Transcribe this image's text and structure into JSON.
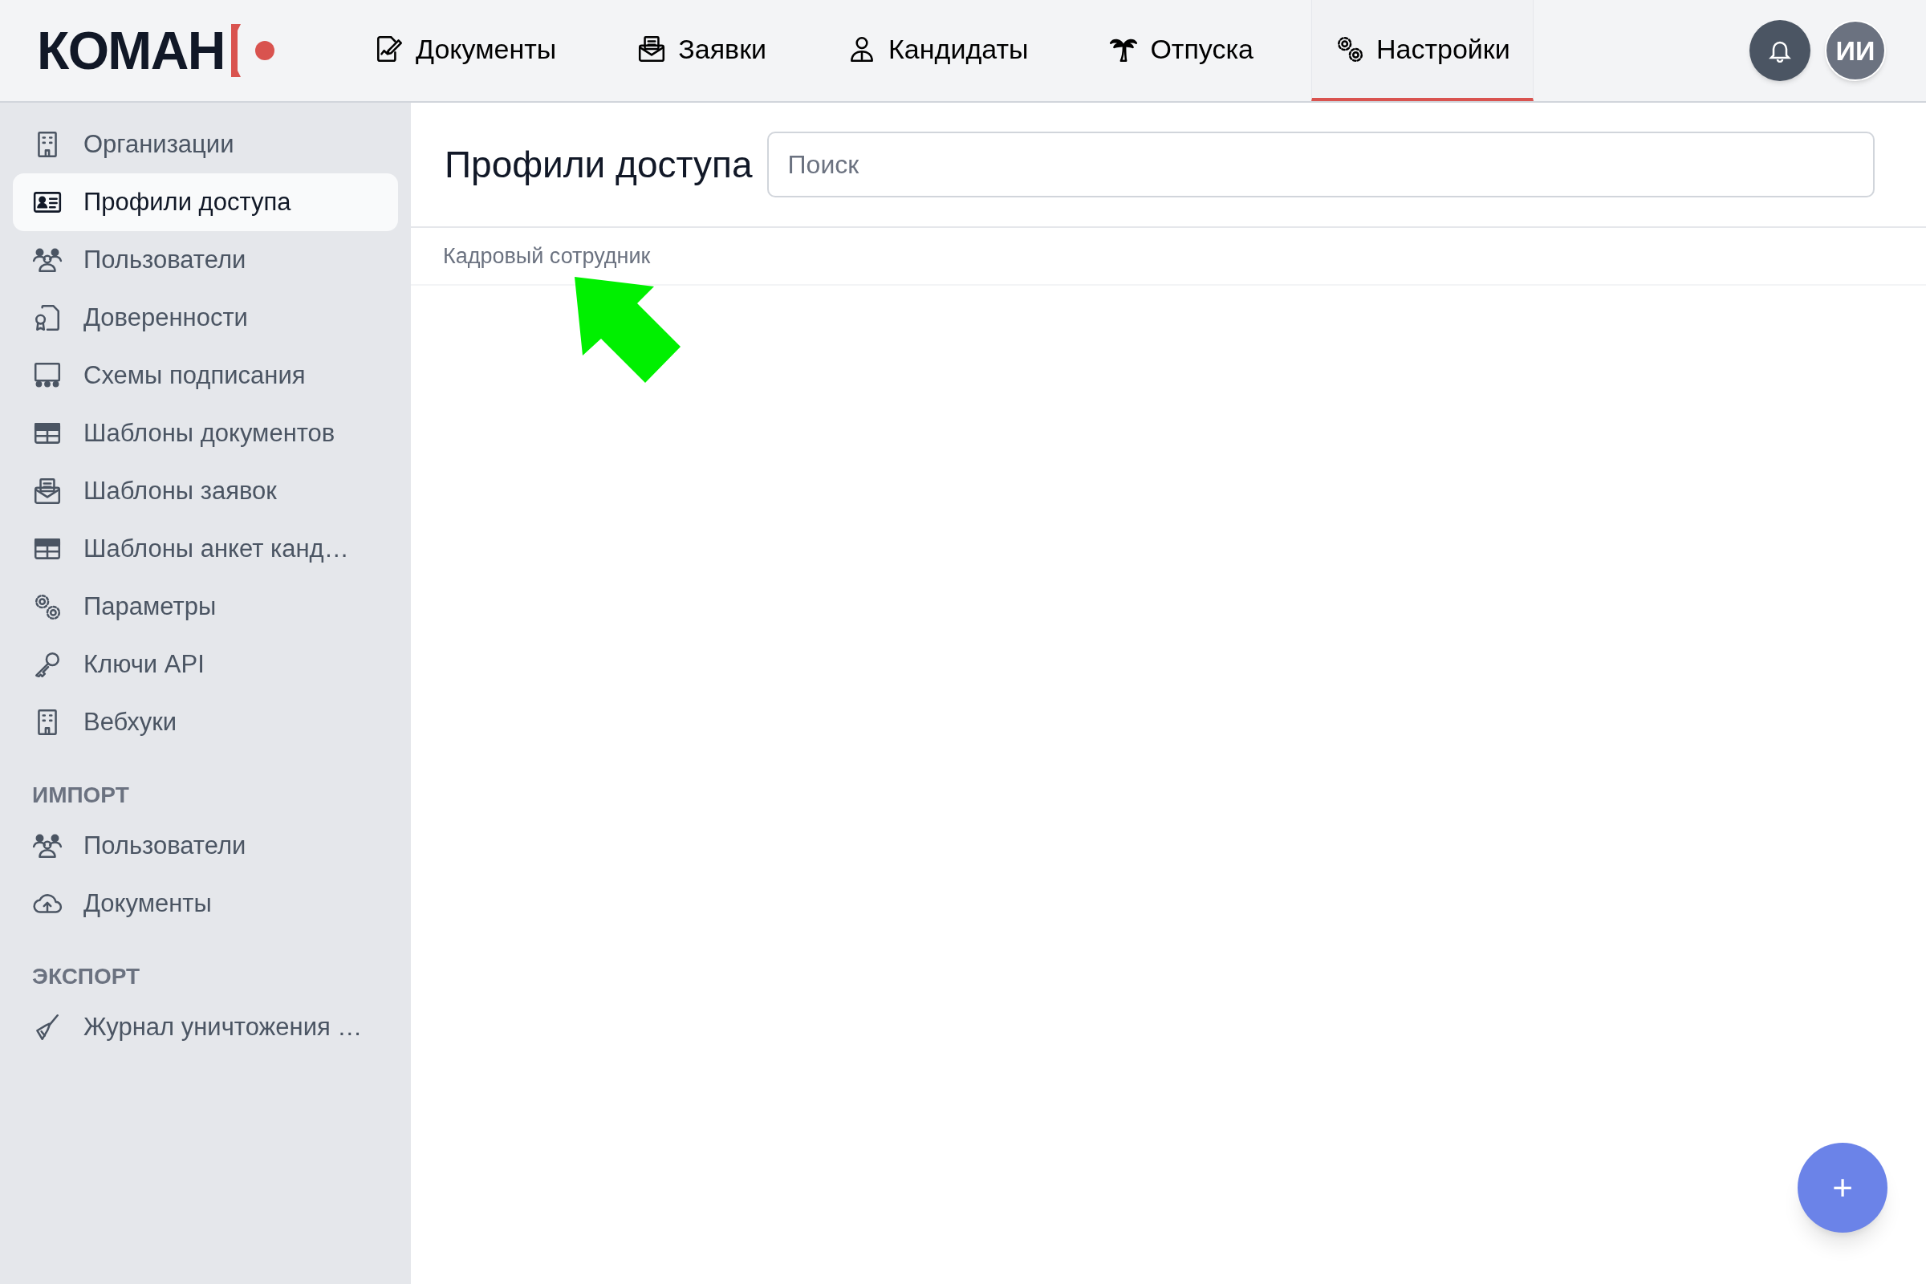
{
  "logo": "КОМАН",
  "nav": [
    {
      "label": "Документы",
      "selected": false
    },
    {
      "label": "Заявки",
      "selected": false
    },
    {
      "label": "Кандидаты",
      "selected": false
    },
    {
      "label": "Отпуска",
      "selected": false
    },
    {
      "label": "Настройки",
      "selected": true
    }
  ],
  "avatar": {
    "initials": "ИИ"
  },
  "sidebar": {
    "sections": [
      {
        "items": [
          {
            "label": "Организации",
            "selected": false
          },
          {
            "label": "Профили доступа",
            "selected": true
          },
          {
            "label": "Пользователи",
            "selected": false
          },
          {
            "label": "Доверенности",
            "selected": false
          },
          {
            "label": "Схемы подписания",
            "selected": false
          },
          {
            "label": "Шаблоны документов",
            "selected": false
          },
          {
            "label": "Шаблоны заявок",
            "selected": false
          },
          {
            "label": "Шаблоны анкет канд…",
            "selected": false
          },
          {
            "label": "Параметры",
            "selected": false
          },
          {
            "label": "Ключи API",
            "selected": false
          },
          {
            "label": "Вебхуки",
            "selected": false
          }
        ]
      },
      {
        "title": "ИМПОРТ",
        "items": [
          {
            "label": "Пользователи",
            "selected": false
          },
          {
            "label": "Документы",
            "selected": false
          }
        ]
      },
      {
        "title": "ЭКСПОРТ",
        "items": [
          {
            "label": "Журнал уничтожения …",
            "selected": false
          }
        ]
      }
    ]
  },
  "page": {
    "title": "Профили доступа",
    "search": {
      "placeholder": "Поиск"
    }
  },
  "profiles": [
    {
      "name": "Кадровый сотрудник"
    }
  ],
  "add_button": {
    "label": "+"
  }
}
